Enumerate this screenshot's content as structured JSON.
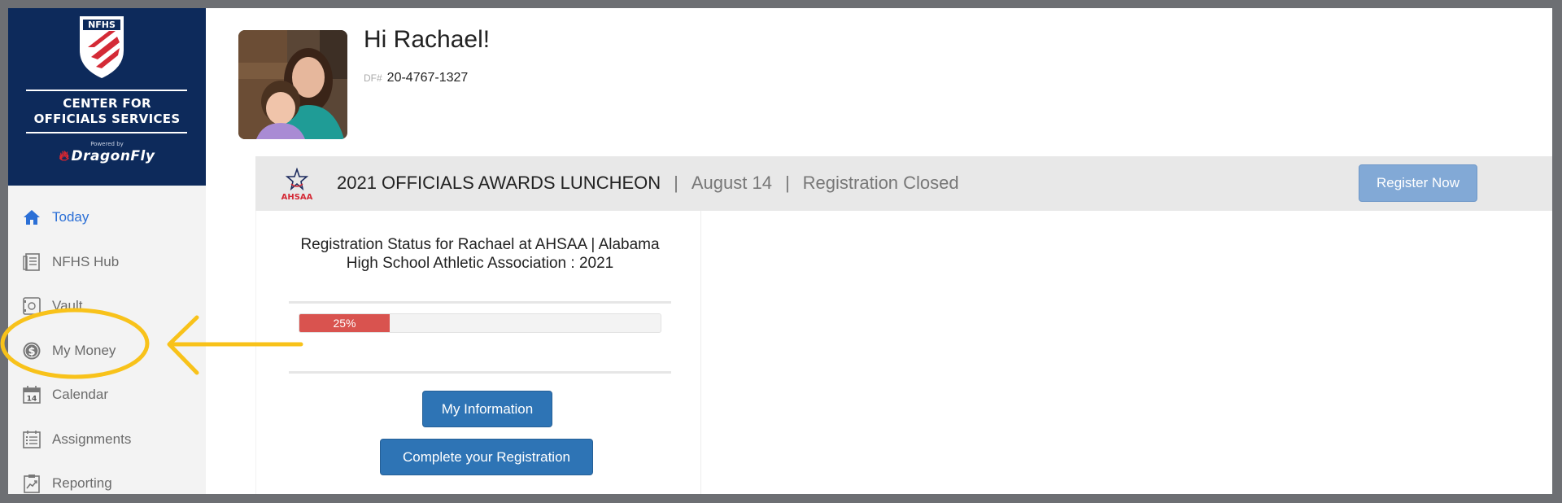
{
  "brand": {
    "shield_text": "NFHS",
    "title_line1": "CENTER FOR",
    "title_line2": "OFFICIALS SERVICES",
    "powered_by": "Powered by",
    "product": "DragonFly"
  },
  "sidebar": {
    "items": [
      {
        "label": "Today",
        "icon": "home-icon",
        "active": true
      },
      {
        "label": "NFHS Hub",
        "icon": "hub-document-icon"
      },
      {
        "label": "Vault",
        "icon": "vault-safe-icon"
      },
      {
        "label": "My Money",
        "icon": "dollar-coin-icon"
      },
      {
        "label": "Calendar",
        "icon": "calendar-icon"
      },
      {
        "label": "Assignments",
        "icon": "assignments-list-icon"
      },
      {
        "label": "Reporting",
        "icon": "reporting-chart-icon"
      }
    ]
  },
  "header": {
    "greeting": "Hi Rachael!",
    "df_prefix": "DF#",
    "df_number": "20-4767-1327"
  },
  "event": {
    "org_logo_text": "AHSAA",
    "name": "2021 OFFICIALS AWARDS LUNCHEON",
    "separator": "|",
    "date": "August 14",
    "status": "Registration Closed",
    "register_button": "Register Now"
  },
  "registration": {
    "status_title": "Registration Status for Rachael at AHSAA | Alabama High School Athletic Association : 2021",
    "progress_label": "25%",
    "progress_percent": 25,
    "my_information_button": "My Information",
    "complete_button": "Complete your Registration"
  },
  "colors": {
    "navy": "#0d2a5b",
    "active_link": "#2b6fd6",
    "progress_red": "#d9534f",
    "button_blue": "#2e74b5",
    "annotation_yellow": "#f8c21a"
  }
}
